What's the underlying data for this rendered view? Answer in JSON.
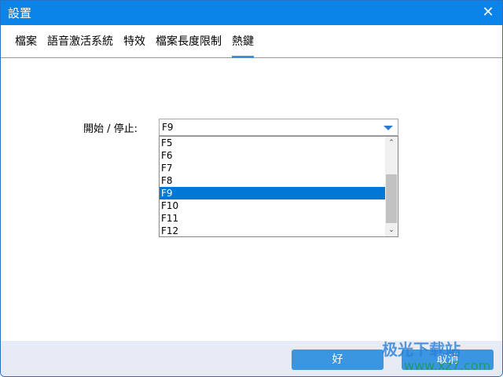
{
  "window": {
    "title": "設置",
    "close_icon": "close-icon"
  },
  "tabs": [
    {
      "label": "檔案"
    },
    {
      "label": "語音激活系統"
    },
    {
      "label": "特效"
    },
    {
      "label": "檔案長度限制"
    },
    {
      "label": "熱鍵",
      "active": true
    }
  ],
  "hotkey": {
    "label": "開始 / 停止:",
    "value": "F9",
    "options": [
      "F5",
      "F6",
      "F7",
      "F8",
      "F9",
      "F10",
      "F11",
      "F12"
    ],
    "selected_index": 4
  },
  "buttons": {
    "ok": "好",
    "cancel": "取消"
  },
  "watermark": {
    "name": "极光下载站",
    "url": "www.xz7.com"
  }
}
